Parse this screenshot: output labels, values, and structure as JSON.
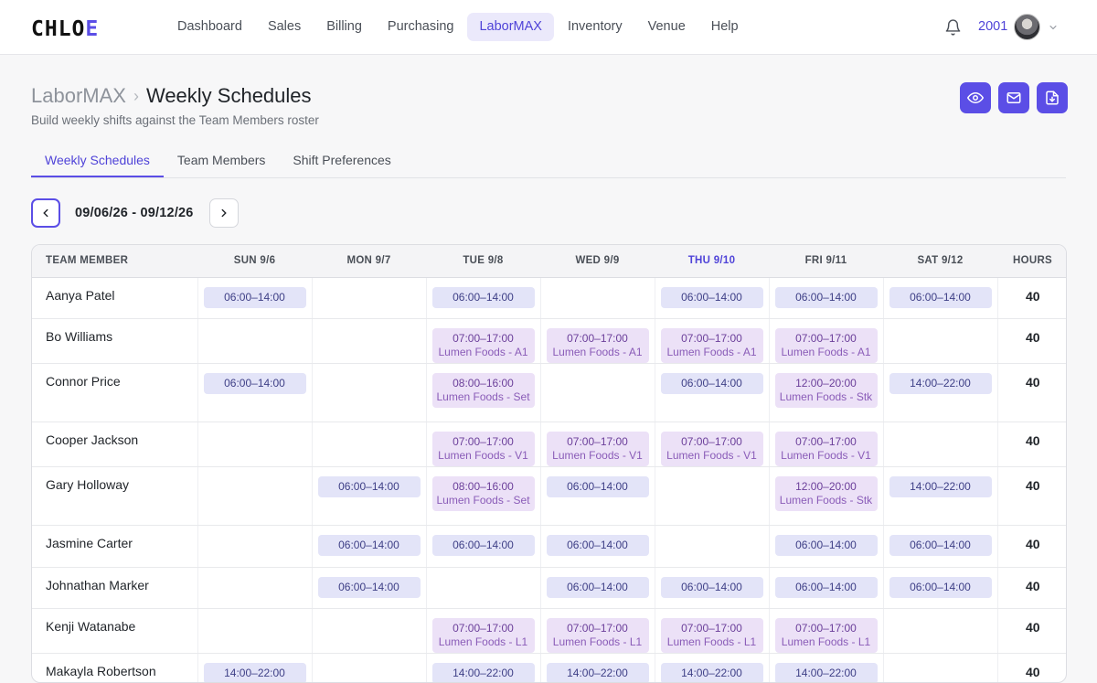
{
  "app": {
    "logo_main": "CHLO",
    "logo_accent": "E"
  },
  "nav": {
    "items": [
      {
        "label": "Dashboard",
        "active": false
      },
      {
        "label": "Sales",
        "active": false
      },
      {
        "label": "Billing",
        "active": false
      },
      {
        "label": "Purchasing",
        "active": false
      },
      {
        "label": "LaborMAX",
        "active": true
      },
      {
        "label": "Inventory",
        "active": false
      },
      {
        "label": "Venue",
        "active": false
      },
      {
        "label": "Help",
        "active": false
      }
    ],
    "user_id": "2001",
    "icons": {
      "notifications": "bell-icon",
      "user_menu": "chevron-down-icon"
    }
  },
  "header": {
    "breadcrumb_parent": "LaborMAX",
    "breadcrumb_separator": "›",
    "title": "Weekly Schedules",
    "subtitle": "Build weekly shifts against the Team Members roster",
    "action_icons": [
      "eye-icon",
      "mail-icon",
      "file-download-icon"
    ]
  },
  "tabs": [
    {
      "label": "Weekly Schedules",
      "active": true
    },
    {
      "label": "Team Members",
      "active": false
    },
    {
      "label": "Shift Preferences",
      "active": false
    }
  ],
  "week": {
    "range": "09/06/26 - 09/12/26"
  },
  "accent_color": "#5b4ee6",
  "table": {
    "columns": [
      "TEAM MEMBER",
      "SUN 9/6",
      "MON 9/7",
      "TUE 9/8",
      "WED 9/9",
      "THU 9/10",
      "FRI 9/11",
      "SAT 9/12",
      "HOURS"
    ],
    "today_column": "THU 9/10",
    "rows": [
      {
        "name": "Aanya Patel",
        "hours": "40",
        "shifts": [
          {
            "time": "06:00–14:00"
          },
          null,
          {
            "time": "06:00–14:00"
          },
          null,
          {
            "time": "06:00–14:00"
          },
          {
            "time": "06:00–14:00"
          },
          {
            "time": "06:00–14:00"
          }
        ]
      },
      {
        "name": "Bo Williams",
        "hours": "40",
        "shifts": [
          null,
          null,
          {
            "time": "07:00–17:00",
            "loc": "Lumen Foods - A1"
          },
          {
            "time": "07:00–17:00",
            "loc": "Lumen Foods - A1"
          },
          {
            "time": "07:00–17:00",
            "loc": "Lumen Foods - A1"
          },
          {
            "time": "07:00–17:00",
            "loc": "Lumen Foods - A1"
          },
          null
        ]
      },
      {
        "name": "Connor Price",
        "hours": "40",
        "shifts": [
          {
            "time": "06:00–14:00"
          },
          null,
          {
            "time": "08:00–16:00",
            "loc": "Lumen Foods - Set"
          },
          null,
          {
            "time": "06:00–14:00"
          },
          {
            "time": "12:00–20:00",
            "loc": "Lumen Foods - Stk"
          },
          {
            "time": "14:00–22:00"
          }
        ]
      },
      {
        "name": "Cooper Jackson",
        "hours": "40",
        "shifts": [
          null,
          null,
          {
            "time": "07:00–17:00",
            "loc": "Lumen Foods - V1"
          },
          {
            "time": "07:00–17:00",
            "loc": "Lumen Foods - V1"
          },
          {
            "time": "07:00–17:00",
            "loc": "Lumen Foods - V1"
          },
          {
            "time": "07:00–17:00",
            "loc": "Lumen Foods - V1"
          },
          null
        ]
      },
      {
        "name": "Gary Holloway",
        "hours": "40",
        "shifts": [
          null,
          {
            "time": "06:00–14:00"
          },
          {
            "time": "08:00–16:00",
            "loc": "Lumen Foods - Set"
          },
          {
            "time": "06:00–14:00"
          },
          null,
          {
            "time": "12:00–20:00",
            "loc": "Lumen Foods - Stk"
          },
          {
            "time": "14:00–22:00"
          }
        ]
      },
      {
        "name": "Jasmine Carter",
        "hours": "40",
        "shifts": [
          null,
          {
            "time": "06:00–14:00"
          },
          {
            "time": "06:00–14:00"
          },
          {
            "time": "06:00–14:00"
          },
          null,
          {
            "time": "06:00–14:00"
          },
          {
            "time": "06:00–14:00"
          }
        ]
      },
      {
        "name": "Johnathan Marker",
        "hours": "40",
        "shifts": [
          null,
          {
            "time": "06:00–14:00"
          },
          null,
          {
            "time": "06:00–14:00"
          },
          {
            "time": "06:00–14:00"
          },
          {
            "time": "06:00–14:00"
          },
          {
            "time": "06:00–14:00"
          }
        ]
      },
      {
        "name": "Kenji Watanabe",
        "hours": "40",
        "shifts": [
          null,
          null,
          {
            "time": "07:00–17:00",
            "loc": "Lumen Foods - L1"
          },
          {
            "time": "07:00–17:00",
            "loc": "Lumen Foods - L1"
          },
          {
            "time": "07:00–17:00",
            "loc": "Lumen Foods - L1"
          },
          {
            "time": "07:00–17:00",
            "loc": "Lumen Foods - L1"
          },
          null
        ]
      },
      {
        "name": "Makayla Robertson",
        "hours": "40",
        "shifts": [
          {
            "time": "14:00–22:00"
          },
          null,
          {
            "time": "14:00–22:00"
          },
          {
            "time": "14:00–22:00"
          },
          {
            "time": "14:00–22:00"
          },
          {
            "time": "14:00–22:00"
          },
          null
        ]
      }
    ]
  }
}
